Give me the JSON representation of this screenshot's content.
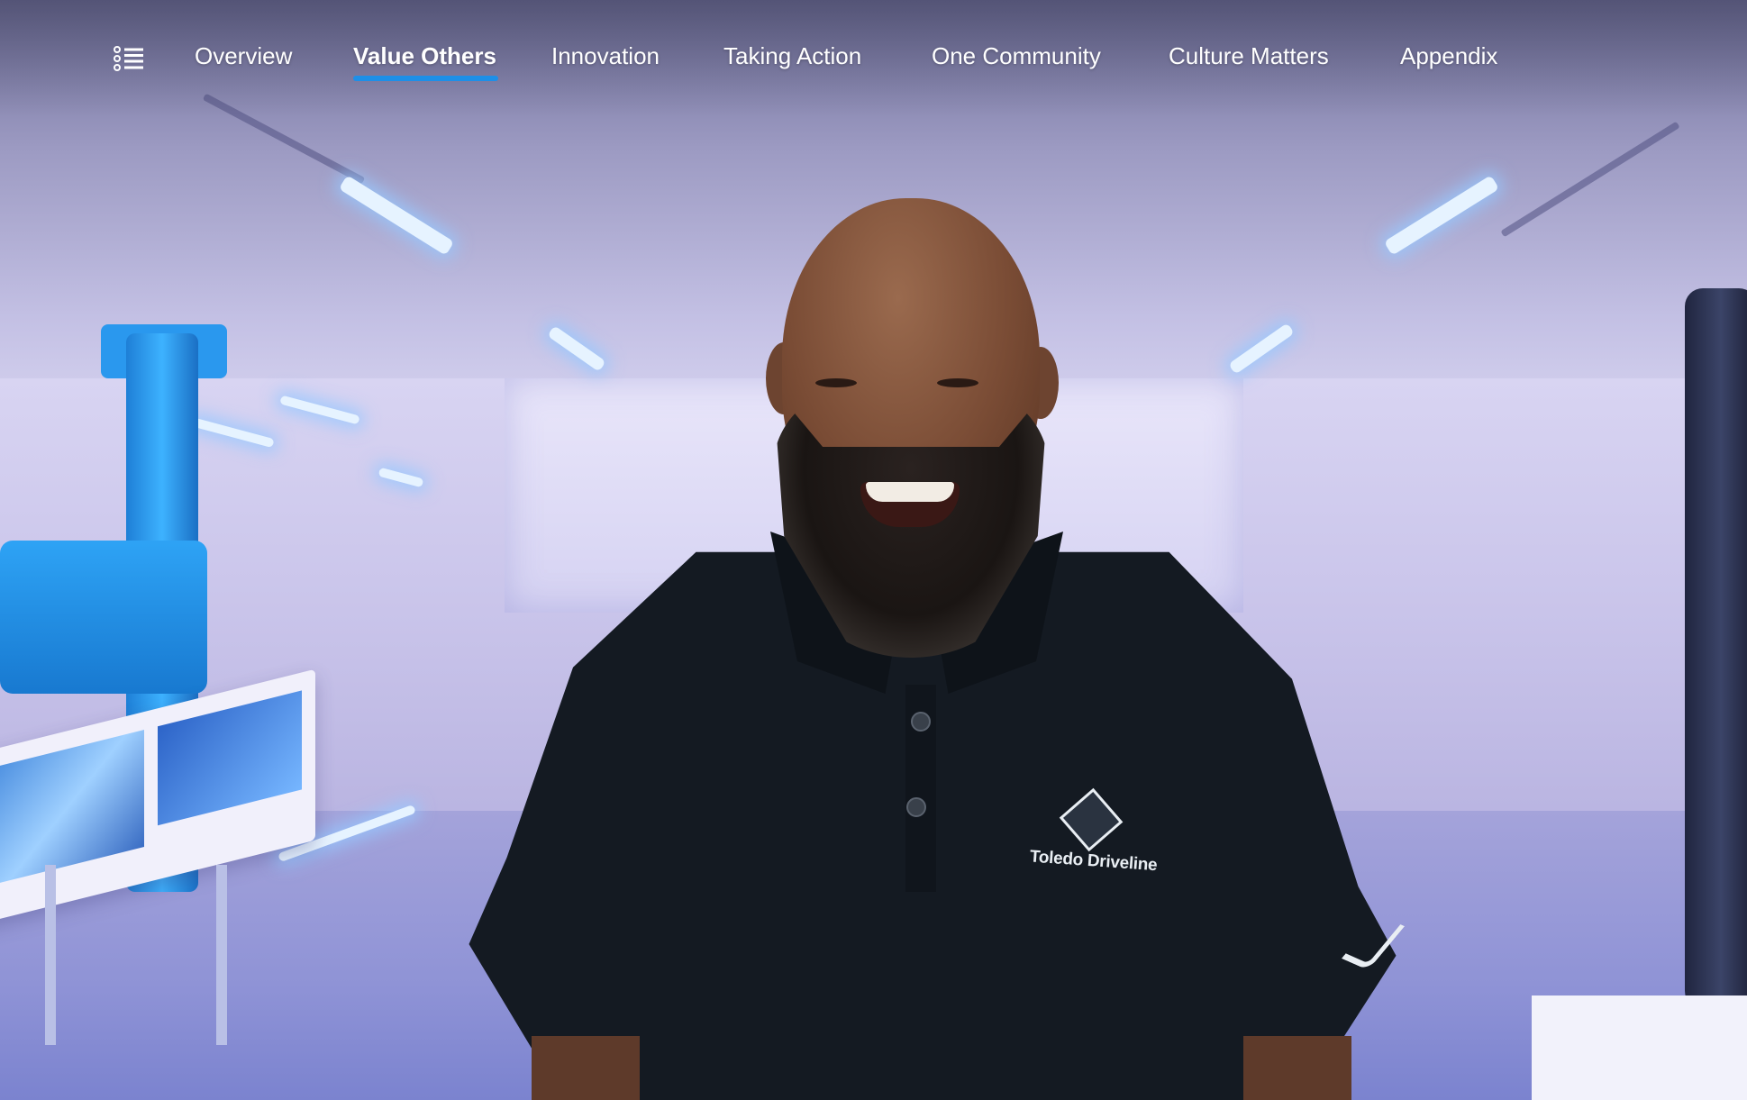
{
  "nav": {
    "menu_icon": "list-icon",
    "items": [
      {
        "label": "Overview",
        "active": false
      },
      {
        "label": "Value Others",
        "active": true
      },
      {
        "label": "Innovation",
        "active": false
      },
      {
        "label": "Taking Action",
        "active": false
      },
      {
        "label": "One Community",
        "active": false
      },
      {
        "label": "Culture Matters",
        "active": false
      },
      {
        "label": "Appendix",
        "active": false
      }
    ],
    "active_color": "#1d8fe8",
    "text_color": "#ffffff"
  },
  "hero": {
    "shirt_logo_text": "Toledo Driveline"
  }
}
